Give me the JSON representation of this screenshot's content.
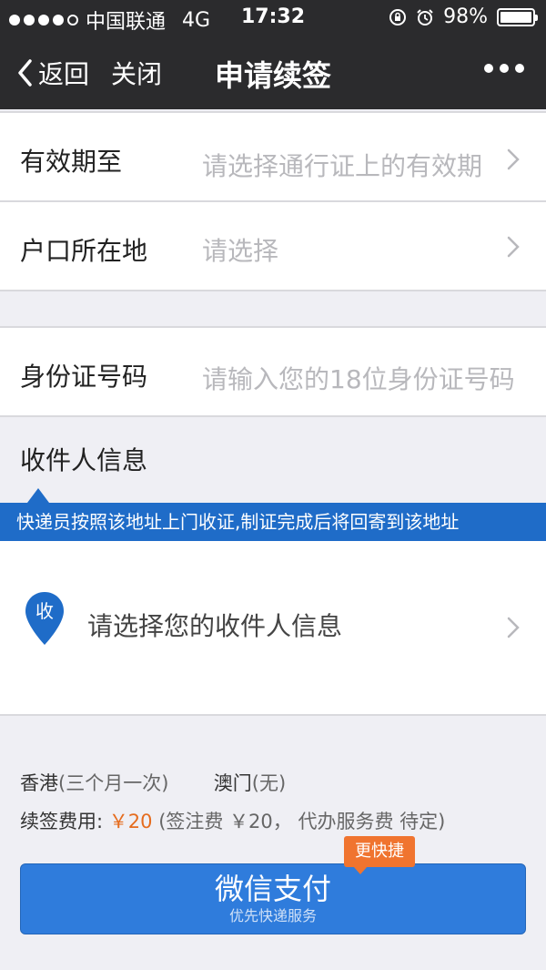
{
  "status_bar": {
    "carrier": "中国联通",
    "network": "4G",
    "time": "17:32",
    "battery": "98%",
    "signal_icon": "signal-dots-icon",
    "lock_icon": "rotation-lock-icon",
    "alarm_icon": "alarm-icon",
    "battery_icon": "battery-icon"
  },
  "nav": {
    "back_label": "返回",
    "close_label": "关闭",
    "title": "申请续签",
    "more_icon": "more-dots-icon"
  },
  "form": {
    "valid_until": {
      "label": "有效期至",
      "placeholder": "请选择通行证上的有效期"
    },
    "hukou": {
      "label": "户口所在地",
      "placeholder": "请选择"
    },
    "id_number": {
      "label": "身份证号码",
      "placeholder": "请输入您的18位身份证号码"
    }
  },
  "recipient": {
    "section_title": "收件人信息",
    "notice": "快递员按照该地址上门收证,制证完成后将回寄到该地址",
    "pin_char": "收",
    "select_label": "请选择您的收件人信息"
  },
  "summary": {
    "hk_label": "香港",
    "hk_value": "(三个月一次)",
    "macau_label": "澳门",
    "macau_value": "(无)",
    "fee_label": "续签费用:",
    "fee_price": "￥20",
    "fee_detail": "(签注费 ￥20， 代办服务费 待定)"
  },
  "pay": {
    "button_label": "微信支付",
    "sub_label": "优先快递服务",
    "badge": "更快捷"
  },
  "colors": {
    "accent_blue": "#1f6cc8",
    "button_blue": "#2f7cdc",
    "price_orange": "#e56c1e",
    "badge_orange": "#f0742f",
    "bar_dark": "#2b2b2d"
  }
}
